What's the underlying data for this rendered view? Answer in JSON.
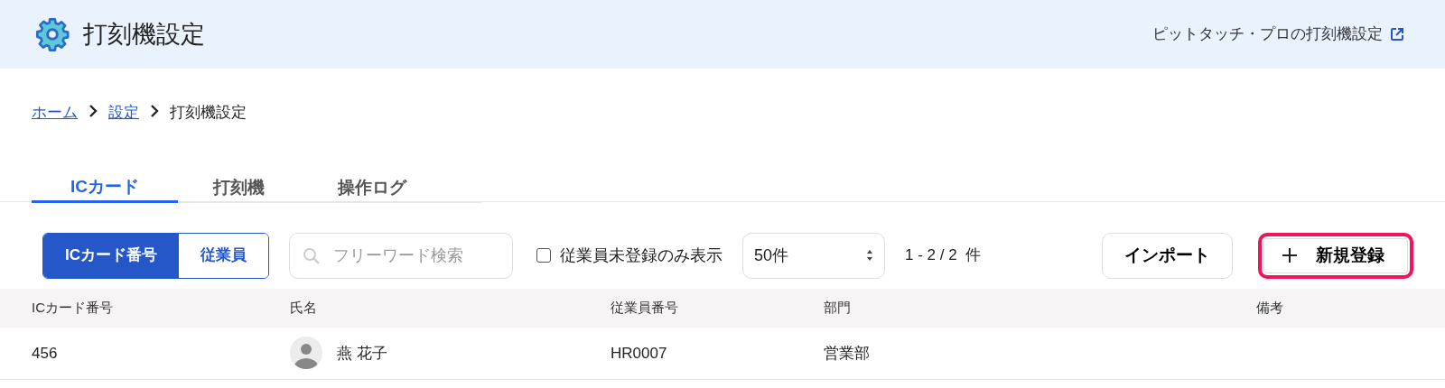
{
  "header": {
    "title": "打刻機設定",
    "link": "ピットタッチ・プロの打刻機設定"
  },
  "breadcrumb": [
    {
      "label": "ホーム",
      "kind": "link"
    },
    {
      "label": "設定",
      "kind": "link"
    },
    {
      "label": "打刻機設定",
      "kind": "current"
    }
  ],
  "tabs": [
    {
      "label": "ICカード",
      "selected": true
    },
    {
      "label": "打刻機",
      "selected": false
    },
    {
      "label": "操作ログ",
      "selected": false
    }
  ],
  "toolbar": {
    "view_toggle": [
      {
        "label": "ICカード番号",
        "selected": true
      },
      {
        "label": "従業員",
        "selected": false
      }
    ],
    "search": {
      "placeholder": "フリーワード検索"
    },
    "filter": {
      "label": "従業員未登録のみ表示",
      "checked": false
    },
    "page_size": "50件",
    "count": "1 - 2 / 2  件",
    "buttons": [
      {
        "label": "インポート",
        "kind": "plain",
        "highlighted": false
      },
      {
        "label": "新規登録",
        "kind": "add",
        "highlighted": true
      }
    ]
  },
  "table": {
    "columns": [
      "ICカード番号",
      "氏名",
      "従業員番号",
      "部門",
      "備考"
    ],
    "rows": [
      {
        "card": "456",
        "name": "燕 花子",
        "employee_no": "HR0007",
        "department": "営業部"
      }
    ]
  }
}
